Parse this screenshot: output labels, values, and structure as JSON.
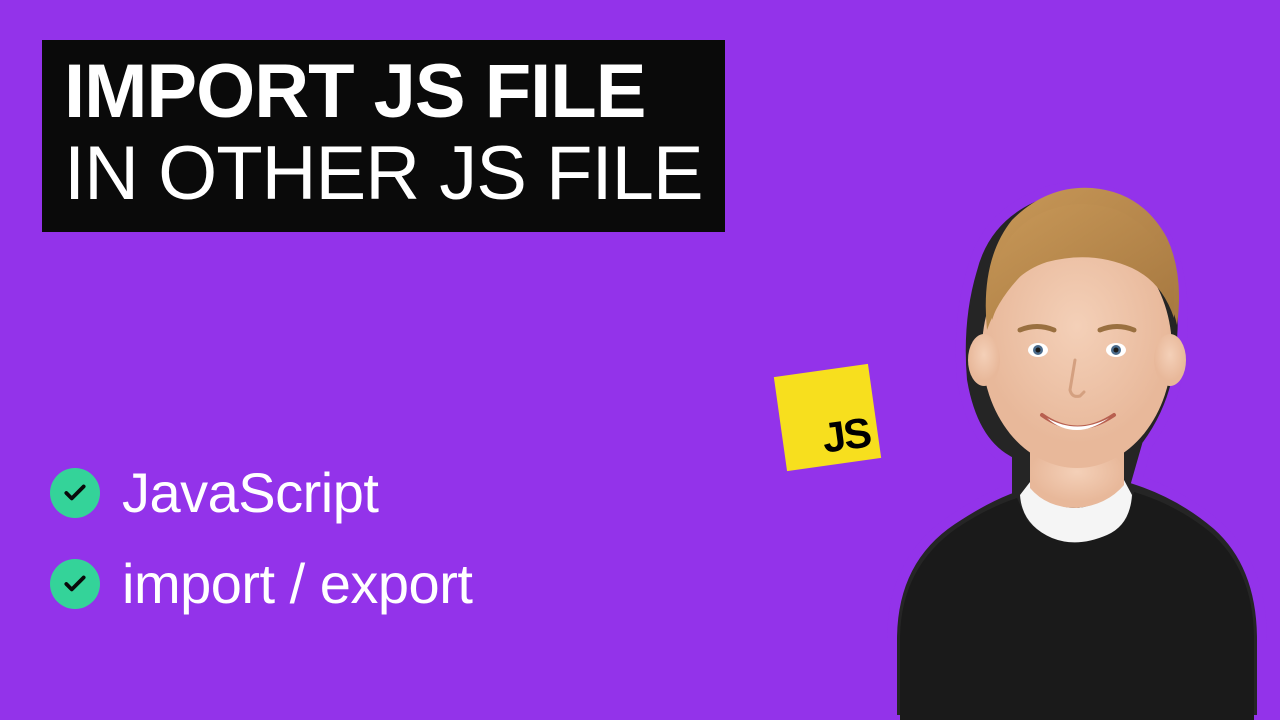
{
  "title": {
    "line1": "IMPORT JS FILE",
    "line2": "IN OTHER JS FILE"
  },
  "bullets": [
    {
      "label": "JavaScript"
    },
    {
      "label": "import / export"
    }
  ],
  "logo": {
    "text": "JS"
  },
  "colors": {
    "background": "#9333ea",
    "title_bg": "#0a0a0a",
    "check_bg": "#34d399",
    "logo_bg": "#f7df1e"
  }
}
